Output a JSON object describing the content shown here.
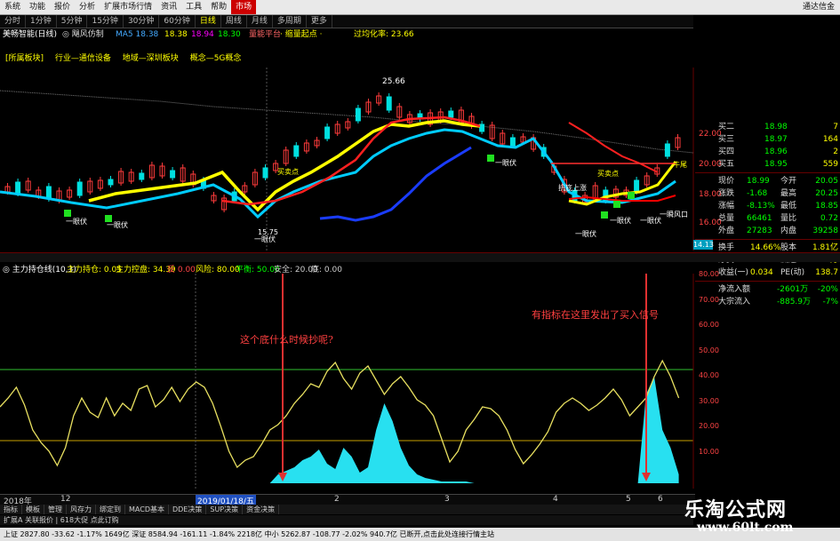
{
  "menu": [
    "系统",
    "功能",
    "报价",
    "分析",
    "扩展市场行情",
    "资讯",
    "工具",
    "帮助",
    "市场"
  ],
  "menu_active_index": 8,
  "menu_right": "通达信金",
  "periods": [
    "分时",
    "1分钟",
    "5分钟",
    "15分钟",
    "30分钟",
    "60分钟",
    "日线",
    "周线",
    "月线",
    "多周期",
    "更多"
  ],
  "period_active_index": 6,
  "indicator_line": {
    "name": "美畅智能(日线)",
    "plugin": "◎ 飓风仿制",
    "ma_values": [
      "MA5 18.38",
      "18.38",
      "18.94",
      "18.30"
    ],
    "mid_a": "量能平台",
    "mid_b": "· 缩量起点 ·",
    "right": "过均化率: 23.66"
  },
  "sectors": [
    "[所属板块]",
    "行业—通信设备",
    "地域—深圳板块",
    "概念—5G概念"
  ],
  "main_chart_labels": {
    "peak": "25.66",
    "low": "15.75",
    "signals": [
      "一眼伏",
      "一眼伏",
      "一眼伏",
      "一眼伏",
      "一眼伏",
      "一眼伏",
      "一眼伏"
    ],
    "buy_points": [
      "买卖点",
      "买卖点"
    ],
    "kangdi": "抗底上涨",
    "break": "一瞬风口",
    "last": "牛尾",
    "tail_price": "14.13"
  },
  "price_axis": [
    "22.00",
    "20.00",
    "18.00",
    "16.00"
  ],
  "sub_indicator": {
    "name": "◎ 主力持仓线(10,3)",
    "items": [
      "主力持仓: 0.05",
      "主力控盘: 34.39",
      "反 0.00",
      "风险: 80.00",
      "平衡: 50.00",
      "安全: 20.00",
      "底: 0.00"
    ]
  },
  "sub_axis": [
    "80.00",
    "70.00",
    "60.00",
    "50.00",
    "40.00",
    "30.00",
    "20.00",
    "10.00"
  ],
  "annotations": {
    "question": "这个底什么时候抄呢?",
    "answer": "有指标在这里发出了买入信号"
  },
  "right_panel": {
    "quotes": [
      {
        "label": "买二",
        "price": "18.98",
        "vol": "7"
      },
      {
        "label": "买三",
        "price": "18.97",
        "vol": "164"
      },
      {
        "label": "买四",
        "price": "18.96",
        "vol": "2"
      },
      {
        "label": "买五",
        "price": "18.95",
        "vol": "559"
      }
    ],
    "stats": [
      {
        "l1": "现价",
        "v1": "18.99",
        "l2": "今开",
        "v2": "20.05"
      },
      {
        "l1": "涨跌",
        "v1": "-1.68",
        "l2": "最高",
        "v2": "20.25"
      },
      {
        "l1": "涨幅",
        "v1": "-8.13%",
        "l2": "最低",
        "v2": "18.85"
      },
      {
        "l1": "总量",
        "v1": "66461",
        "l2": "量比",
        "v2": "0.72"
      },
      {
        "l1": "外盘",
        "v1": "27283",
        "l2": "内盘",
        "v2": "39258"
      }
    ],
    "stats2": [
      {
        "l1": "换手",
        "v1": "14.66%",
        "l2": "股本",
        "v2": "1.81亿"
      },
      {
        "l1": "净资",
        "v1": "2.95",
        "l2": "流通",
        "v2": "4534万"
      },
      {
        "l1": "收益(一)",
        "v1": "0.034",
        "l2": "PE(动)",
        "v2": "138.7"
      }
    ],
    "flows": [
      {
        "l": "净流入额",
        "v1": "-2601万",
        "v2": "-20%"
      },
      {
        "l": "大宗流入",
        "v1": "-885.9万",
        "v2": "-7%"
      }
    ]
  },
  "date_bar": [
    "2018年",
    "12",
    "2019/01/18/五",
    "2",
    "3",
    "4",
    "5",
    "6"
  ],
  "tabs": [
    "指标",
    "模板",
    "管理",
    "风存力",
    "绑定到",
    "MACD基本",
    "DDE决策",
    "SUP决策",
    "资金决策"
  ],
  "tabs2": "扩展A 关联报价 | 618大促 点此订购",
  "status": "上证 2827.80 -33.62 -1.17% 1649亿  深证 8584.94 -161.11 -1.84% 2218亿  中小 5262.87 -108.77 -2.02% 940.7亿     已断开,点击此处连接行情主站",
  "watermark": {
    "line1": "乐淘公式网",
    "line2": "www.60lt.com"
  },
  "colors": {
    "up": "#ff3b3b",
    "down": "#00e0e0",
    "yellow": "#ffff00",
    "cyan": "#00ffff",
    "green_line": "#30c030"
  }
}
